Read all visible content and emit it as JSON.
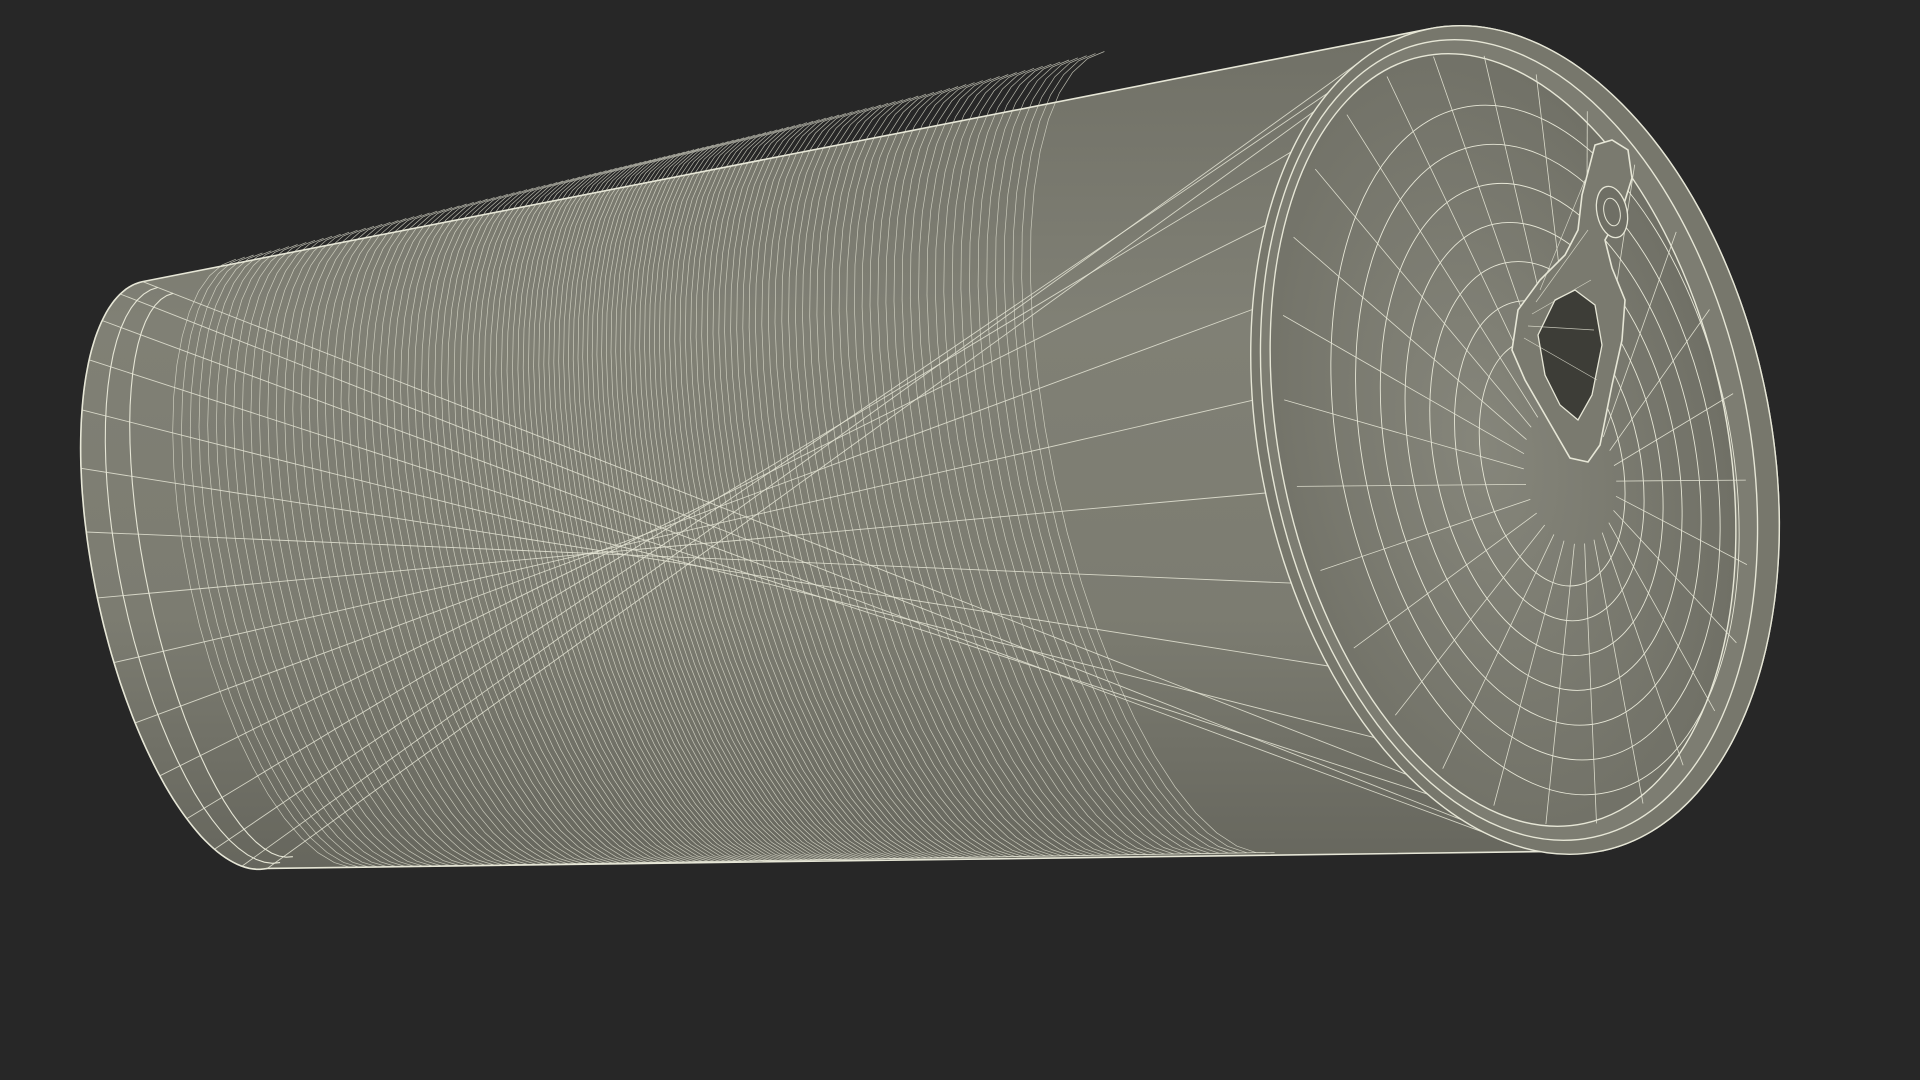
{
  "viewport": {
    "background_color": "#272727",
    "object": "wireframe-soda-can",
    "render_mode": "wireframe-on-shaded"
  },
  "model": {
    "surface_color": "#7f7f74",
    "surface_dark_color": "#6d6d63",
    "wire_color": "#e6e6d6",
    "body_rings": 130,
    "body_segments": 14,
    "lid_rings": 7,
    "lid_segments": 28
  }
}
